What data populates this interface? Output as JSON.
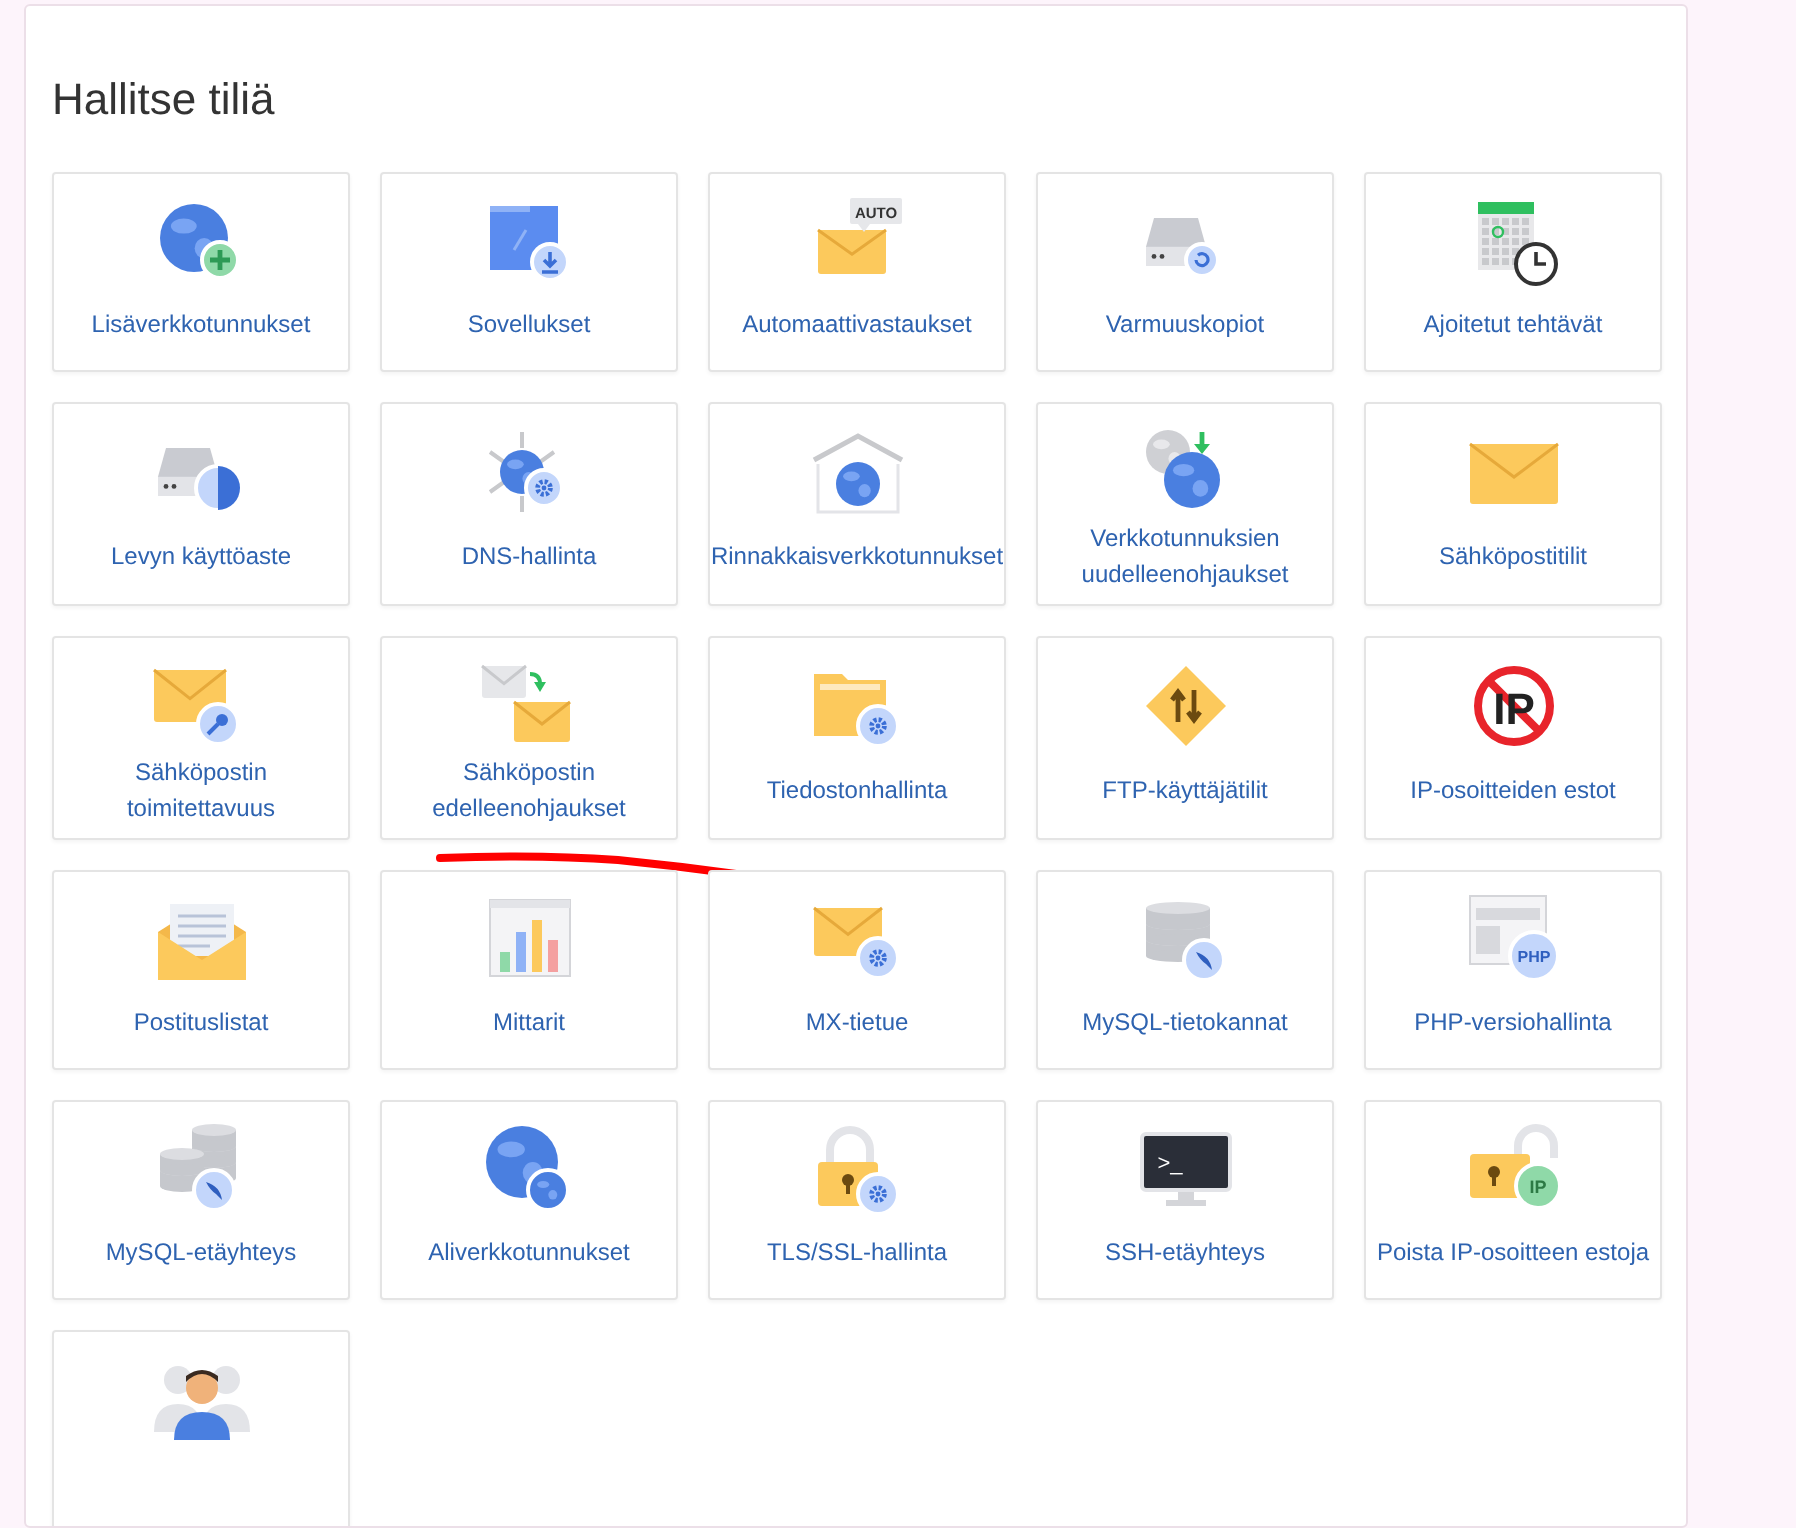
{
  "panel": {
    "title": "Hallitse tiliä"
  },
  "tiles": [
    {
      "label": "Lisäverkkotunnukset"
    },
    {
      "label": "Sovellukset"
    },
    {
      "label": "Automaattivastaukset",
      "icon_text": "AUTO"
    },
    {
      "label": "Varmuuskopiot"
    },
    {
      "label": "Ajoitetut tehtävät"
    },
    {
      "label": "Levyn käyttöaste"
    },
    {
      "label": "DNS-hallinta"
    },
    {
      "label": "Rinnakkaisverkkotunnukset"
    },
    {
      "label": "Verkkotunnuksien uudelleenohjaukset"
    },
    {
      "label": "Sähköpostitilit"
    },
    {
      "label": "Sähköpostin toimitettavuus"
    },
    {
      "label": "Sähköpostin edelleenohjaukset"
    },
    {
      "label": "Tiedostonhallinta"
    },
    {
      "label": "FTP-käyttäjätilit"
    },
    {
      "label": "IP-osoitteiden estot",
      "icon_text": "IP"
    },
    {
      "label": "Postituslistat"
    },
    {
      "label": "Mittarit"
    },
    {
      "label": "MX-tietue"
    },
    {
      "label": "MySQL-tietokannat"
    },
    {
      "label": "PHP-versiohallinta",
      "icon_text": "PHP"
    },
    {
      "label": "MySQL-etäyhteys"
    },
    {
      "label": "Aliverkkotunnukset"
    },
    {
      "label": "TLS/SSL-hallinta"
    },
    {
      "label": "SSH-etäyhteys",
      "icon_text": ">_"
    },
    {
      "label": "Poista IP-osoitteen estoja",
      "icon_text": "IP"
    },
    {
      "partial": true
    }
  ]
}
